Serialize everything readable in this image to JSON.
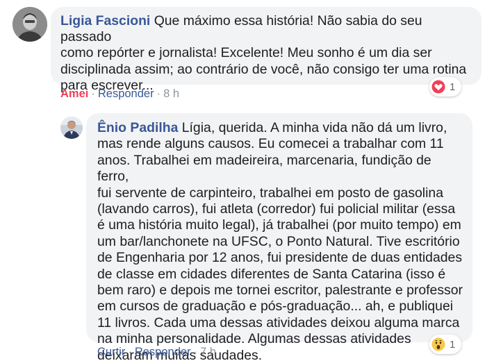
{
  "comment": {
    "author": "Ligia Fascioni",
    "text": "Que máximo essa história! Não sabia do seu passado\ncomo repórter e jornalista! Excelente! Meu sonho é um dia ser\ndisciplinada assim; ao contrário de você, não consigo ter uma rotina\npara escrever...",
    "actions": {
      "like": "Amei",
      "reply": "Responder",
      "time": "8 h"
    },
    "reaction": {
      "icon": "love-reaction-icon",
      "count": "1"
    }
  },
  "reply": {
    "author": "Ênio Padilha",
    "text": "Lígia, querida. A minha vida não dá um livro,\nmas rende alguns causos. Eu comecei a trabalhar com 11\nanos. Trabalhei em madeireira, marcenaria, fundição de ferro,\nfui servente de carpinteiro, trabalhei em posto de gasolina\n(lavando carros), fui atleta (corredor) fui policial militar (essa\né uma história muito legal), já trabalhei (por muito tempo) em\num bar/lanchonete na UFSC, o Ponto Natural. Tive escritório\nde Engenharia por 12 anos, fui presidente de duas entidades\nde classe em cidades diferentes de Santa Catarina (isso é\nbem raro) e depois me tornei escritor, palestrante e professor\nem cursos de graduação e pós-graduação... ah, e publiquei\n11 livros. Cada uma dessas atividades deixou alguma marca\nna minha personalidade. Algumas dessas atividades\ndeixaram muitas saudades.",
    "actions": {
      "like": "Curtir",
      "reply": "Responder",
      "time": "7 h"
    },
    "reaction": {
      "icon": "wow-reaction-icon",
      "count": "1"
    }
  },
  "colors": {
    "name": "#385898",
    "love": "#f33e58",
    "bubble": "#f2f3f5",
    "meta": "#90949c"
  }
}
